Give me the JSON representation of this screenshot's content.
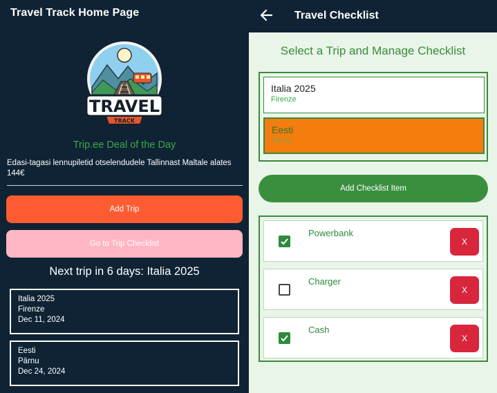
{
  "home": {
    "title": "Travel Track Home Page",
    "logo_text": "TRAVEL",
    "logo_subtext": "TRACK",
    "deal_title": "Trip.ee Deal of the Day",
    "deal_text": "Edasi-tagasi lennupiletid otselendudele Tallinnast Maltale alates 144€",
    "add_trip_label": "Add Trip",
    "checklist_label": "Go to Trip Checklist",
    "next_trip": "Next trip in 6 days: Italia 2025",
    "trips": [
      {
        "name": "Italia 2025",
        "city": "Firenze",
        "date": "Dec 11, 2024"
      },
      {
        "name": "Eesti",
        "city": "Pärnu",
        "date": "Dec 24, 2024"
      }
    ]
  },
  "checklist": {
    "title": "Travel Checklist",
    "section_title": "Select a Trip and Manage Checklist",
    "trips": [
      {
        "name": "Italia 2025",
        "city": "Firenze",
        "selected": false
      },
      {
        "name": "Eesti",
        "city": "Pärnu",
        "selected": true
      }
    ],
    "add_item_label": "Add Checklist Item",
    "items": [
      {
        "label": "Powerbank",
        "checked": true,
        "delete_label": "X"
      },
      {
        "label": "Charger",
        "checked": false,
        "delete_label": "X"
      },
      {
        "label": "Cash",
        "checked": true,
        "delete_label": "X"
      }
    ]
  },
  "colors": {
    "dark_bg": "#0f2334",
    "primary_orange": "#ff5b33",
    "pink": "#ffb6c2",
    "green": "#3a8a3a",
    "selected_orange": "#f57c0e",
    "delete_red": "#d8263d",
    "light_green_bg": "#e9f5e9"
  },
  "icons": {
    "back": "arrow-left-icon",
    "checked": "checkmark-icon",
    "logo": "travel-track-logo"
  }
}
